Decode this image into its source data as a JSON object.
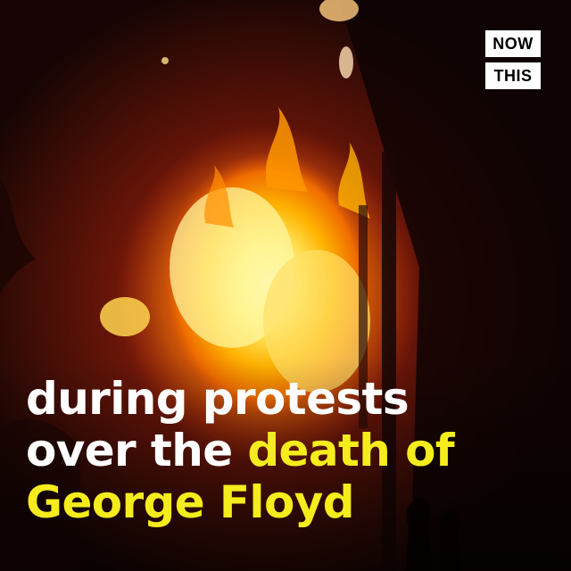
{
  "scene": {
    "description_icon": "fire-photo",
    "colors": {
      "flame_core": "#fff176",
      "flame_mid": "#ffb300",
      "flame_outer": "#e64a19",
      "background": "#120403",
      "caption_white": "#ffffff",
      "caption_yellow": "#f5ec1d"
    }
  },
  "logo": {
    "top": "NOW",
    "bottom": "THIS"
  },
  "caption": {
    "line1": "during protests",
    "line2_white": "over the ",
    "line2_yellow": "death of",
    "line3_yellow": "George Floyd"
  }
}
